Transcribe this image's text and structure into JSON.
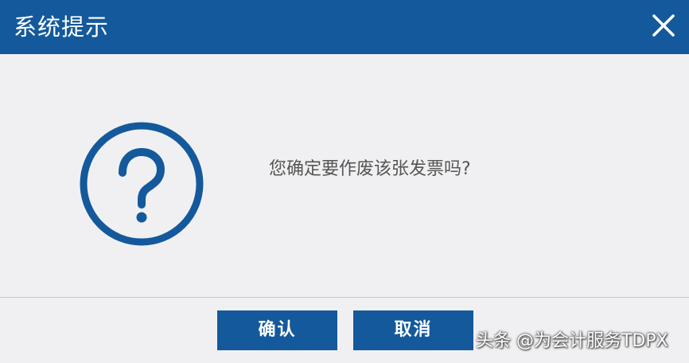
{
  "dialog": {
    "title": "系统提示",
    "message": "您确定要作废该张发票吗?",
    "icon": "question-circle-icon"
  },
  "buttons": {
    "confirm_label": "确认",
    "cancel_label": "取消"
  },
  "watermark": {
    "text": "头条 @为会计服务TDPX"
  },
  "colors": {
    "primary": "#14599c",
    "background": "#f0f0f2",
    "message_text": "#555555"
  }
}
